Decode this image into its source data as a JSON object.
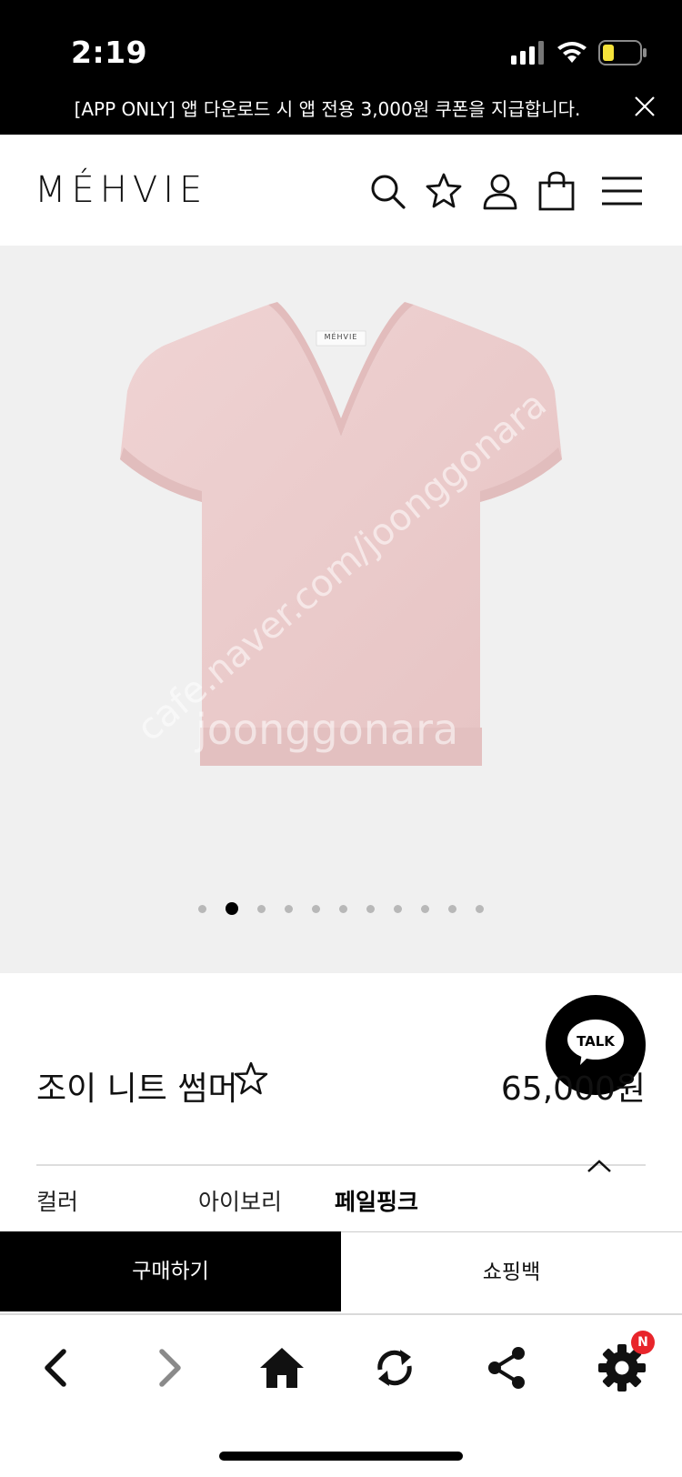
{
  "status_bar": {
    "time": "2:19"
  },
  "banner": {
    "text": "[APP ONLY] 앱 다운로드 시 앱 전용 3,000원 쿠폰을 지급합니다."
  },
  "header": {
    "logo": "MÉHVIE"
  },
  "gallery": {
    "image_label": "MÉHVIE",
    "watermark_primary": "joonggonara",
    "watermark_secondary": "cafe.naver.com/joonggonara",
    "dot_count": 11,
    "active_dot": 1
  },
  "talk_button": {
    "label": "TALK"
  },
  "product": {
    "name": "조이 니트 썸머",
    "price": "65,000원"
  },
  "options": {
    "label": "컬러",
    "values": [
      "아이보리",
      "페일핑크"
    ],
    "selected": "페일핑크"
  },
  "actions": {
    "buy": "구매하기",
    "shopping_bag": "쇼핑백"
  },
  "toolbar": {
    "badge": "N"
  },
  "colors": {
    "accent": "#000000",
    "knit": "#eacaca",
    "badge": "#e8252b",
    "gallery_bg": "#f0f0f0"
  }
}
